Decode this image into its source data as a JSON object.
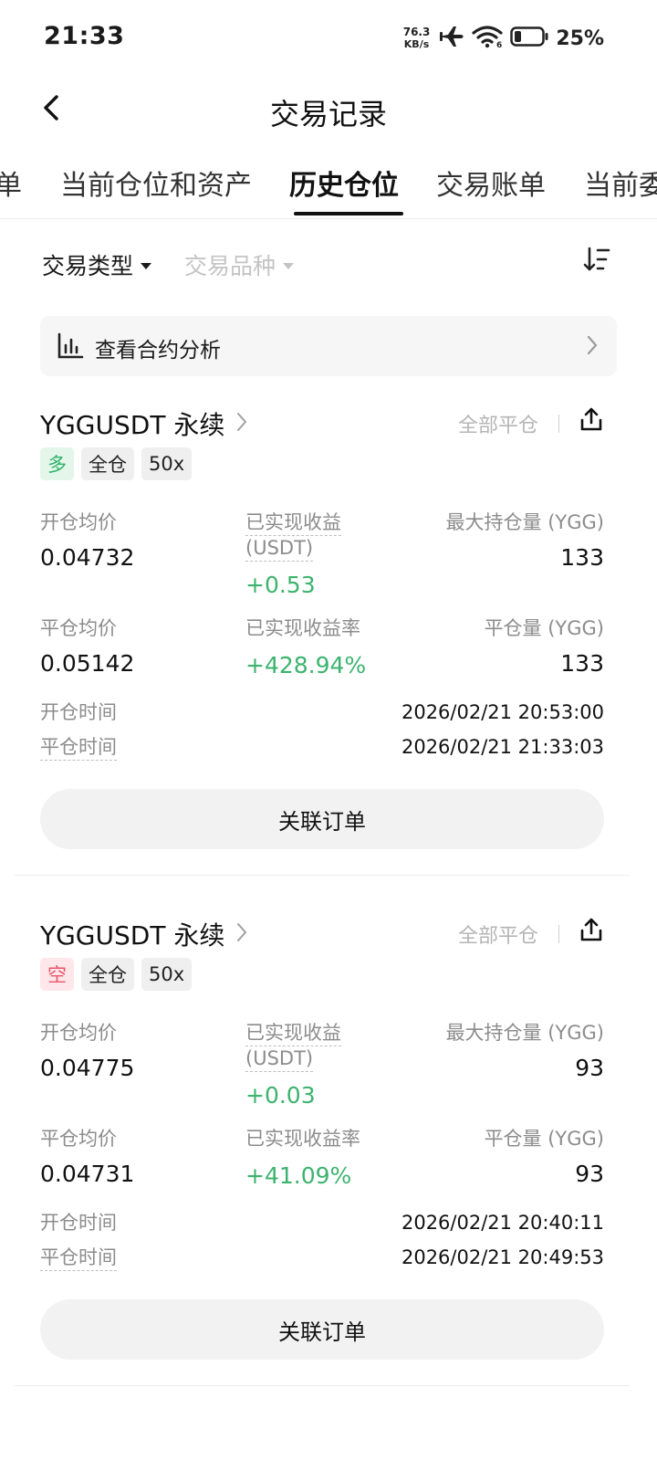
{
  "status_bar": {
    "time": "21:33",
    "net_speed_value": "76.3",
    "net_speed_unit": "KB/s",
    "battery_percent": "25%",
    "battery_level": 0.25
  },
  "header": {
    "title": "交易记录"
  },
  "tabs": [
    {
      "label": "单",
      "active": false
    },
    {
      "label": "当前仓位和资产",
      "active": false
    },
    {
      "label": "历史仓位",
      "active": true
    },
    {
      "label": "交易账单",
      "active": false
    },
    {
      "label": "当前委",
      "active": false
    }
  ],
  "filters": {
    "trade_type": "交易类型",
    "symbol": "交易品种"
  },
  "analysis_banner": {
    "label": "查看合约分析"
  },
  "positions": [
    {
      "symbol": "YGGUSDT 永续",
      "close_type": "全部平仓",
      "side": "多",
      "side_type": "long",
      "margin_mode": "全仓",
      "leverage": "50x",
      "labels": {
        "open_avg": "开仓均价",
        "realized_pnl": "已实现收益",
        "realized_pnl_unit": "(USDT)",
        "max_position": "最大持仓量 (YGG)",
        "close_avg": "平仓均价",
        "realized_pnl_rate": "已实现收益率",
        "closed_qty": "平仓量 (YGG)",
        "open_time": "开仓时间",
        "close_time": "平仓时间"
      },
      "open_avg": "0.04732",
      "realized_pnl": "+0.53",
      "max_position": "133",
      "close_avg": "0.05142",
      "realized_pnl_rate": "+428.94%",
      "closed_qty": "133",
      "open_time": "2026/02/21 20:53:00",
      "close_time": "2026/02/21 21:33:03",
      "related_orders": "关联订单"
    },
    {
      "symbol": "YGGUSDT 永续",
      "close_type": "全部平仓",
      "side": "空",
      "side_type": "short",
      "margin_mode": "全仓",
      "leverage": "50x",
      "labels": {
        "open_avg": "开仓均价",
        "realized_pnl": "已实现收益",
        "realized_pnl_unit": "(USDT)",
        "max_position": "最大持仓量 (YGG)",
        "close_avg": "平仓均价",
        "realized_pnl_rate": "已实现收益率",
        "closed_qty": "平仓量 (YGG)",
        "open_time": "开仓时间",
        "close_time": "平仓时间"
      },
      "open_avg": "0.04775",
      "realized_pnl": "+0.03",
      "max_position": "93",
      "close_avg": "0.04731",
      "realized_pnl_rate": "+41.09%",
      "closed_qty": "93",
      "open_time": "2026/02/21 20:40:11",
      "close_time": "2026/02/21 20:49:53",
      "related_orders": "关联订单"
    }
  ],
  "colors": {
    "profit": "#3db36e",
    "long_tag_bg": "#e4f6ea",
    "short_tag_bg": "#fde7ea",
    "muted": "#8c8c8c"
  }
}
